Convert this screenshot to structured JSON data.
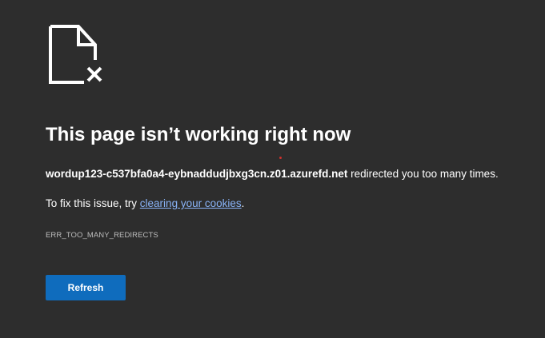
{
  "icon": "broken-page-icon",
  "title": "This page isn’t working right now",
  "message": {
    "host": "wordup123-c537bfa0a4-eybnaddudjbxg3cn.z01.azurefd.net",
    "suffix": " redirected you too many times."
  },
  "fix": {
    "prefix": "To fix this issue, try ",
    "link": "clearing your cookies",
    "suffix": "."
  },
  "error_code": "ERR_TOO_MANY_REDIRECTS",
  "button": {
    "label": "Refresh"
  },
  "colors": {
    "background": "#2d2d2d",
    "accent": "#0f6cbd",
    "link": "#8ab4f8"
  }
}
